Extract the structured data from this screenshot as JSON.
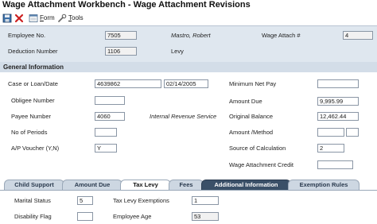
{
  "window": {
    "title": "Wage Attachment Workbench - Wage Attachment Revisions"
  },
  "toolbar": {
    "form_label": "Form",
    "form_underline": "F",
    "tools_label": "Tools",
    "tools_underline": "T"
  },
  "header": {
    "employee_no_label": "Employee No.",
    "employee_no_value": "7505",
    "employee_name": "Mastro, Robert",
    "wage_attach_label": "Wage Attach #",
    "wage_attach_value": "4",
    "deduction_number_label": "Deduction Number",
    "deduction_number_value": "1106",
    "deduction_name": "Levy"
  },
  "general": {
    "section_title": "General Information",
    "case_loan_date_label": "Case or Loan/Date",
    "case_number_value": "4639862",
    "case_date_value": "02/14/2005",
    "obligee_number_label": "Obligee Number",
    "obligee_number_value": "",
    "payee_number_label": "Payee Number",
    "payee_number_value": "4060",
    "payee_name": "Internal Revenue Service",
    "no_of_periods_label": "No of Periods",
    "no_of_periods_value": "",
    "ap_voucher_label": "A/P Voucher (Y,N)",
    "ap_voucher_value": "Y",
    "minimum_net_pay_label": "Minimum Net Pay",
    "minimum_net_pay_value": "",
    "amount_due_label": "Amount Due",
    "amount_due_value": "9,995.99",
    "original_balance_label": "Original Balance",
    "original_balance_value": "12,462.44",
    "amount_method_label": "Amount /Method",
    "amount_value": "",
    "method_value": "",
    "source_of_calc_label": "Source of Calculation",
    "source_of_calc_value": "2",
    "wage_attach_credit_label": "Wage Attachment Credit",
    "wage_attach_credit_value": ""
  },
  "tabs": [
    {
      "label": "Child Support"
    },
    {
      "label": "Amount Due"
    },
    {
      "label": "Tax Levy"
    },
    {
      "label": "Fees"
    },
    {
      "label": "Additional Information"
    },
    {
      "label": "Exemption Rules"
    }
  ],
  "tax_levy": {
    "marital_status_label": "Marital Status",
    "marital_status_value": "5",
    "disability_flag_label": "Disability Flag",
    "disability_flag_value": "",
    "tax_levy_exemptions_label": "Tax Levy Exemptions",
    "tax_levy_exemptions_value": "1",
    "employee_age_label": "Employee Age",
    "employee_age_value": "53"
  }
}
